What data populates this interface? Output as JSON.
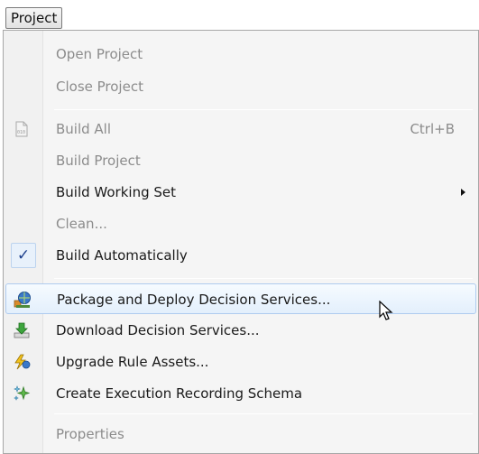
{
  "menubar": {
    "title": "Project"
  },
  "menu": {
    "open_project": "Open Project",
    "close_project": "Close Project",
    "build_all": "Build All",
    "build_all_shortcut": "Ctrl+B",
    "build_project": "Build Project",
    "build_working_set": "Build Working Set",
    "clean": "Clean...",
    "build_automatically": "Build Automatically",
    "build_automatically_checked": true,
    "package_deploy": "Package and Deploy Decision Services...",
    "download": "Download Decision Services...",
    "upgrade": "Upgrade Rule Assets...",
    "create_schema": "Create Execution Recording Schema",
    "properties": "Properties"
  },
  "icons": {
    "build_all": "binary-file-icon",
    "build_automatically": "checkmark-icon",
    "package_deploy": "deploy-globe-icon",
    "download": "download-icon",
    "upgrade": "upgrade-lightning-icon",
    "create_schema": "sparkle-icon"
  },
  "colors": {
    "highlight": "#e3effc",
    "disabled_text": "#8c8c8c",
    "check": "#1c3f8c"
  }
}
